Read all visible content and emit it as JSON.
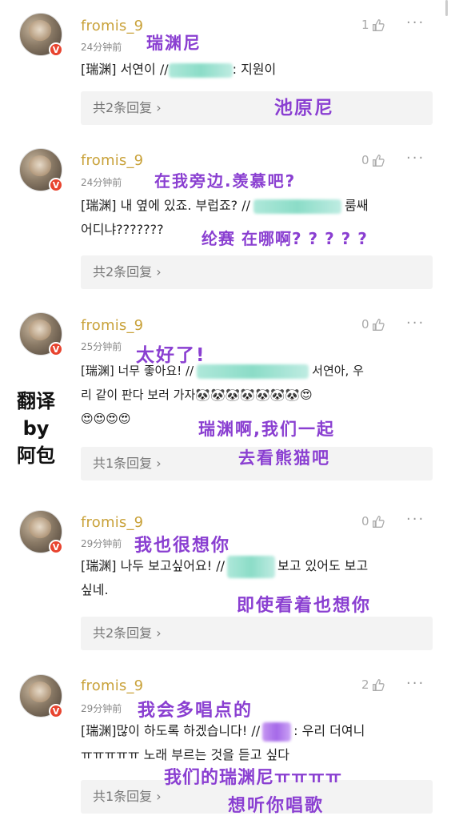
{
  "comments": [
    {
      "username": "fromis_9",
      "time": "24分钟前",
      "likes": "1",
      "prefix": "[瑞渊] 서연이 //",
      "text_after": ": 지원이",
      "text_line2": "",
      "reply": "共2条回复 ›",
      "annotations": [
        "瑞渊尼",
        "池原尼"
      ]
    },
    {
      "username": "fromis_9",
      "time": "24分钟前",
      "likes": "0",
      "prefix": "[瑞渊] 내 옆에 있죠. 부럽죠? //",
      "text_after": "룸쌔",
      "text_line2": "어디냐???????",
      "reply": "共2条回复 ›",
      "annotations": [
        "在我旁边.羡慕吧?",
        "纶赛 在哪啊? ? ? ? ?"
      ]
    },
    {
      "username": "fromis_9",
      "time": "25分钟前",
      "likes": "0",
      "prefix": "[瑞渊] 너무 좋아요! //",
      "text_after": "서연아, 우",
      "text_line2": "리 같이 판다 보러 가자🐼🐼🐼🐼🐼🐼🐼😍",
      "text_line3": "😍😍😍😍",
      "reply": "共1条回复 ›",
      "annotations": [
        "太好了!",
        "瑞渊啊,我们一起",
        "去看熊猫吧"
      ]
    },
    {
      "username": "fromis_9",
      "time": "29分钟前",
      "likes": "0",
      "prefix": "[瑞渊] 나두 보고싶어요! //",
      "text_after": "보고 있어도 보고",
      "text_line2": "싶네.",
      "reply": "共2条回复 ›",
      "annotations": [
        "我也很想你",
        "即使看着也想你"
      ]
    },
    {
      "username": "fromis_9",
      "time": "29分钟前",
      "likes": "2",
      "prefix": "[瑞渊]많이 하도록 하겠습니다! //",
      "text_after": ": 우리 더여니",
      "text_line2": "ㅠㅠㅠㅠㅠ 노래 부르는 것을 듣고 싶다",
      "reply": "共1条回复 ›",
      "annotations": [
        "我会多唱点的",
        "我们的瑞渊尼ㅠㅠㅠㅠ",
        "想听你唱歌"
      ]
    }
  ],
  "translator_credit": [
    "翻译",
    "by",
    "阿包"
  ],
  "colors": {
    "username": "#c9a23a",
    "badge": "#e8442f",
    "annotation": "#8a3fd1"
  }
}
